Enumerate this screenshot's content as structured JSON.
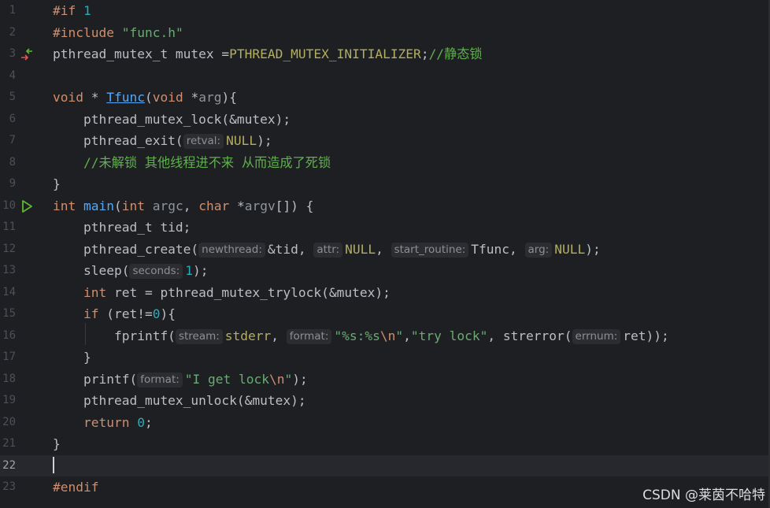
{
  "editor": {
    "current_line": 22,
    "lines": [
      {
        "n": "1",
        "tokens": [
          {
            "t": "#if ",
            "c": "kw"
          },
          {
            "t": "1",
            "c": "num"
          }
        ]
      },
      {
        "n": "2",
        "tokens": [
          {
            "t": "#include ",
            "c": "kw"
          },
          {
            "t": "\"func.h\"",
            "c": "str"
          }
        ]
      },
      {
        "n": "3",
        "marker": "override-arrows-icon",
        "tokens": [
          {
            "t": "pthread_mutex_t mutex ="
          },
          {
            "t": "PTHREAD_MUTEX_INITIALIZER",
            "c": "macro"
          },
          {
            "t": ";"
          },
          {
            "t": "//静态锁",
            "c": "cmt"
          }
        ]
      },
      {
        "n": "4",
        "tokens": []
      },
      {
        "n": "5",
        "tokens": [
          {
            "t": "void",
            "c": "kw"
          },
          {
            "t": " * "
          },
          {
            "t": "Tfunc",
            "c": "fn-decl"
          },
          {
            "t": "("
          },
          {
            "t": "void",
            "c": "kw"
          },
          {
            "t": " *"
          },
          {
            "t": "arg",
            "c": "param"
          },
          {
            "t": "){"
          }
        ]
      },
      {
        "n": "6",
        "tokens": [
          {
            "t": "    pthread_mutex_lock(&mutex);"
          }
        ]
      },
      {
        "n": "7",
        "tokens": [
          {
            "t": "    pthread_exit("
          },
          {
            "hint": "retval:"
          },
          {
            "t": "NULL",
            "c": "macro"
          },
          {
            "t": ");"
          }
        ]
      },
      {
        "n": "8",
        "tokens": [
          {
            "t": "    "
          },
          {
            "t": "//未解锁 其他线程进不来 从而造成了死锁",
            "c": "cmt"
          }
        ]
      },
      {
        "n": "9",
        "tokens": [
          {
            "t": "}"
          }
        ]
      },
      {
        "n": "10",
        "marker": "run-icon",
        "tokens": [
          {
            "t": "int",
            "c": "kw"
          },
          {
            "t": " "
          },
          {
            "t": "main",
            "c": "fn"
          },
          {
            "t": "("
          },
          {
            "t": "int",
            "c": "kw"
          },
          {
            "t": " "
          },
          {
            "t": "argc",
            "c": "param"
          },
          {
            "t": ", "
          },
          {
            "t": "char",
            "c": "kw"
          },
          {
            "t": " *"
          },
          {
            "t": "argv",
            "c": "param"
          },
          {
            "t": "[]) {"
          }
        ]
      },
      {
        "n": "11",
        "tokens": [
          {
            "t": "    pthread_t tid;"
          }
        ]
      },
      {
        "n": "12",
        "tokens": [
          {
            "t": "    pthread_create("
          },
          {
            "hint": "newthread:"
          },
          {
            "t": "&tid, "
          },
          {
            "hint": "attr:"
          },
          {
            "t": "NULL",
            "c": "macro"
          },
          {
            "t": ", "
          },
          {
            "hint": "start_routine:"
          },
          {
            "t": "Tfunc, "
          },
          {
            "hint": "arg:"
          },
          {
            "t": "NULL",
            "c": "macro"
          },
          {
            "t": ");"
          }
        ]
      },
      {
        "n": "13",
        "tokens": [
          {
            "t": "    sleep("
          },
          {
            "hint": "seconds:"
          },
          {
            "t": "1",
            "c": "num"
          },
          {
            "t": ");"
          }
        ]
      },
      {
        "n": "14",
        "tokens": [
          {
            "t": "    "
          },
          {
            "t": "int",
            "c": "kw"
          },
          {
            "t": " ret = pthread_mutex_trylock(&mutex);"
          }
        ]
      },
      {
        "n": "15",
        "tokens": [
          {
            "t": "    "
          },
          {
            "t": "if",
            "c": "kw"
          },
          {
            "t": " (ret!="
          },
          {
            "t": "0",
            "c": "num"
          },
          {
            "t": "){"
          }
        ]
      },
      {
        "n": "16",
        "tokens": [
          {
            "t": "        fprintf("
          },
          {
            "hint": "stream:"
          },
          {
            "t": "stderr",
            "c": "macro"
          },
          {
            "t": ", "
          },
          {
            "hint": "format:"
          },
          {
            "t": "\"%s:%s",
            "c": "str"
          },
          {
            "t": "\\n",
            "c": "esc"
          },
          {
            "t": "\"",
            "c": "str"
          },
          {
            "t": ","
          },
          {
            "t": "\"try lock\"",
            "c": "str"
          },
          {
            "t": ", strerror("
          },
          {
            "hint": "errnum:"
          },
          {
            "t": "ret));"
          }
        ]
      },
      {
        "n": "17",
        "tokens": [
          {
            "t": "    }"
          }
        ]
      },
      {
        "n": "18",
        "tokens": [
          {
            "t": "    printf("
          },
          {
            "hint": "format:"
          },
          {
            "t": "\"I get lock",
            "c": "str"
          },
          {
            "t": "\\n",
            "c": "esc"
          },
          {
            "t": "\"",
            "c": "str"
          },
          {
            "t": ");"
          }
        ]
      },
      {
        "n": "19",
        "tokens": [
          {
            "t": "    pthread_mutex_unlock(&mutex);"
          }
        ]
      },
      {
        "n": "20",
        "tokens": [
          {
            "t": "    "
          },
          {
            "t": "return",
            "c": "kw"
          },
          {
            "t": " "
          },
          {
            "t": "0",
            "c": "num"
          },
          {
            "t": ";"
          }
        ]
      },
      {
        "n": "21",
        "tokens": [
          {
            "t": "}"
          }
        ]
      },
      {
        "n": "22",
        "tokens": []
      },
      {
        "n": "23",
        "tokens": [
          {
            "t": "#endif",
            "c": "kw"
          }
        ]
      }
    ]
  },
  "watermark": "CSDN @莱茵不哈特",
  "colors": {
    "background": "#1e1f22",
    "keyword": "#cf8e6d",
    "number": "#2aacb8",
    "string": "#6aab73",
    "macro": "#b3ae60",
    "function": "#56a8f5",
    "comment": "#5fb14d"
  }
}
